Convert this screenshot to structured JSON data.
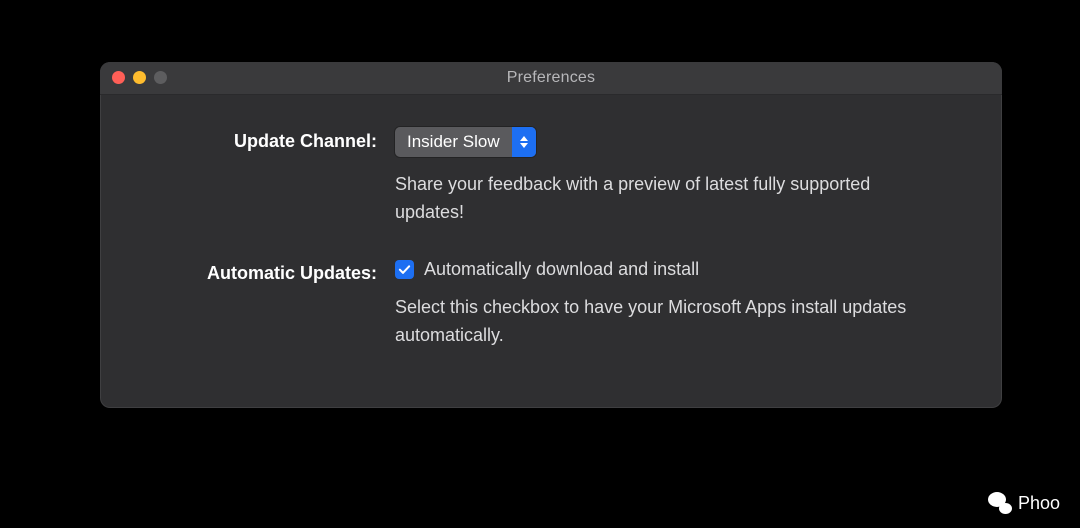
{
  "window": {
    "title": "Preferences"
  },
  "updateChannel": {
    "label": "Update Channel:",
    "selected": "Insider Slow",
    "helper": "Share your feedback with a preview of latest fully supported updates!"
  },
  "automaticUpdates": {
    "label": "Automatic Updates:",
    "checkboxLabel": "Automatically download and install",
    "checked": true,
    "helper": "Select this checkbox to have your Microsoft Apps install updates automatically."
  },
  "watermark": {
    "text": "Phoo"
  }
}
